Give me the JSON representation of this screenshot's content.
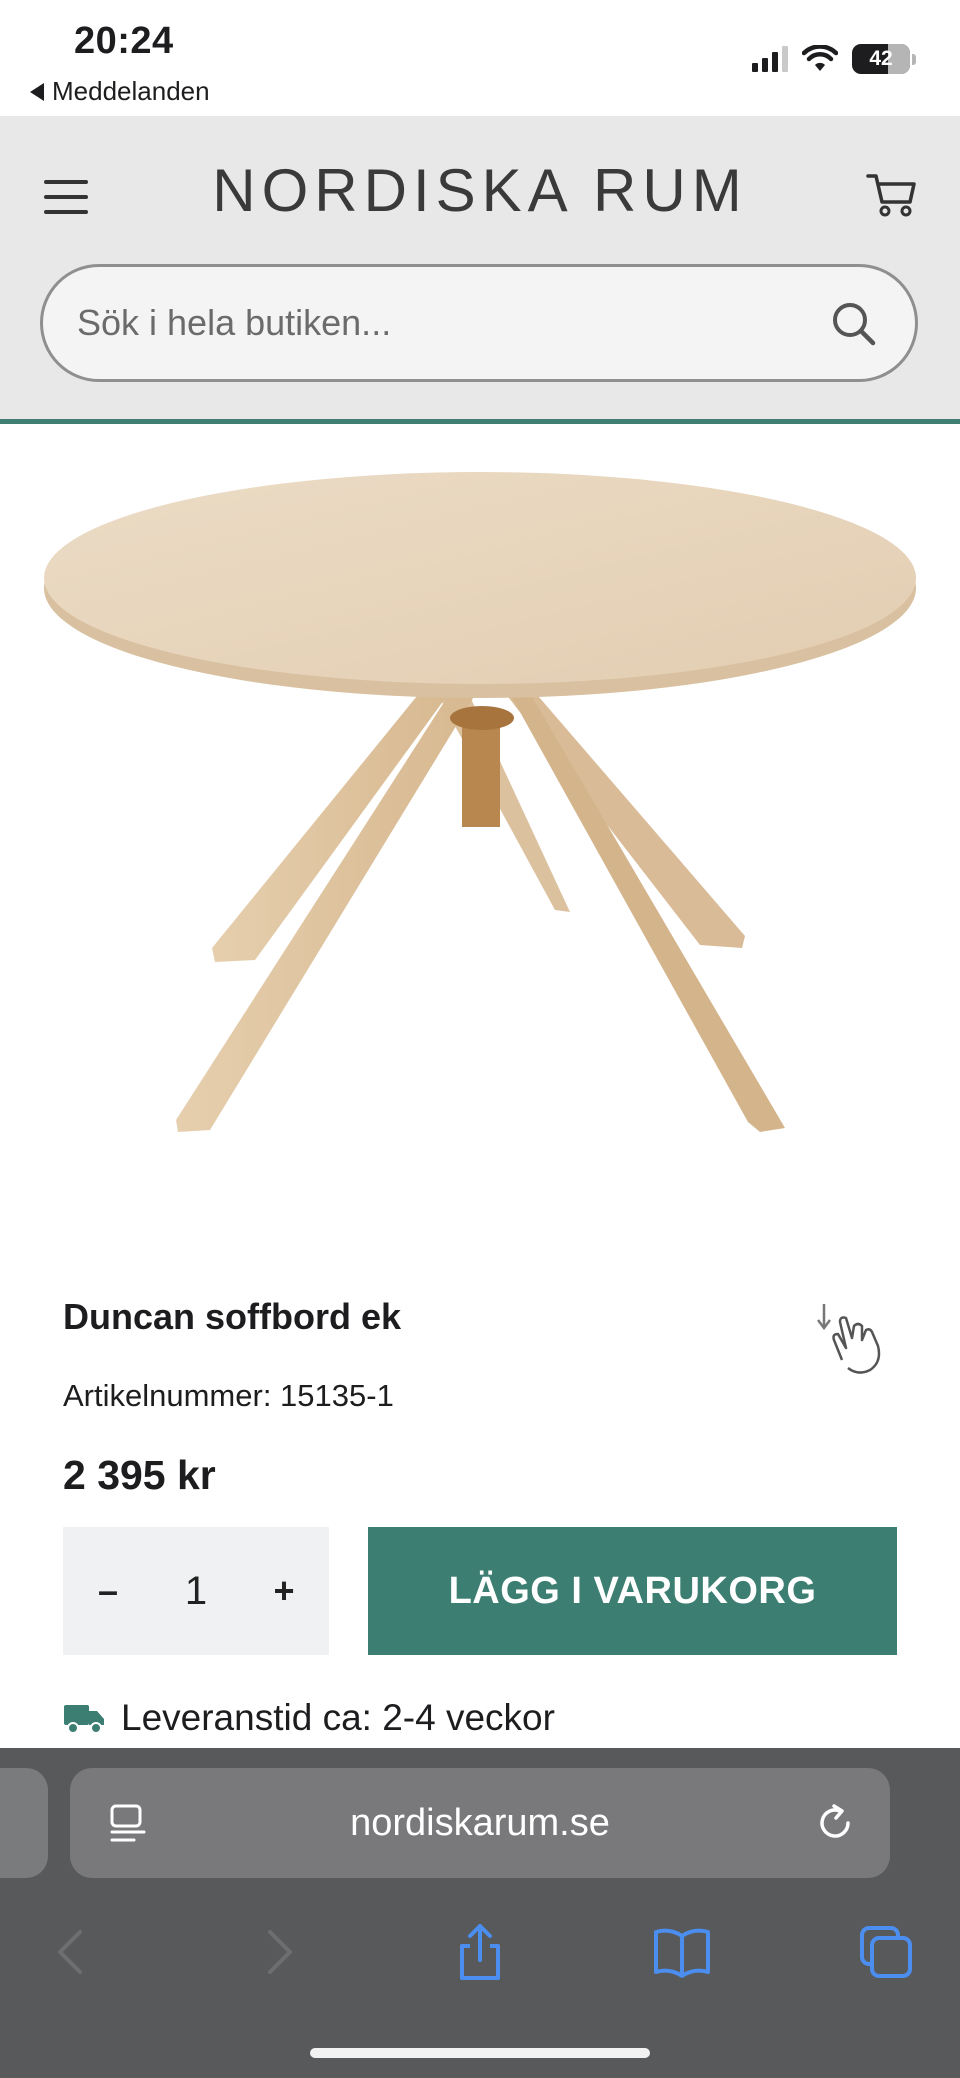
{
  "status_bar": {
    "time": "20:24",
    "back_label": "Meddelanden",
    "battery": "42"
  },
  "header": {
    "logo": "NORDISKA RUM",
    "search_placeholder": "Sök i hela butiken..."
  },
  "product": {
    "title": "Duncan soffbord ek",
    "sku": "Artikelnummer: 15135-1",
    "price": "2 395 kr",
    "quantity": "1",
    "minus_label": "–",
    "plus_label": "+",
    "add_to_cart_label": "LÄGG I VARUKORG",
    "delivery": "Leveranstid ca: 2-4 veckor"
  },
  "browser": {
    "url": "nordiskarum.se"
  },
  "colors": {
    "accent": "#3c7f72",
    "header_bg": "#e7e8e7",
    "ios_blue": "#4b8ef0"
  },
  "icons": [
    "menu-icon",
    "cart-icon",
    "search-icon",
    "zoom-hand-icon",
    "truck-icon",
    "reader-icon",
    "reload-icon",
    "back-icon",
    "forward-icon",
    "share-icon",
    "bookmarks-icon",
    "tabs-icon"
  ]
}
